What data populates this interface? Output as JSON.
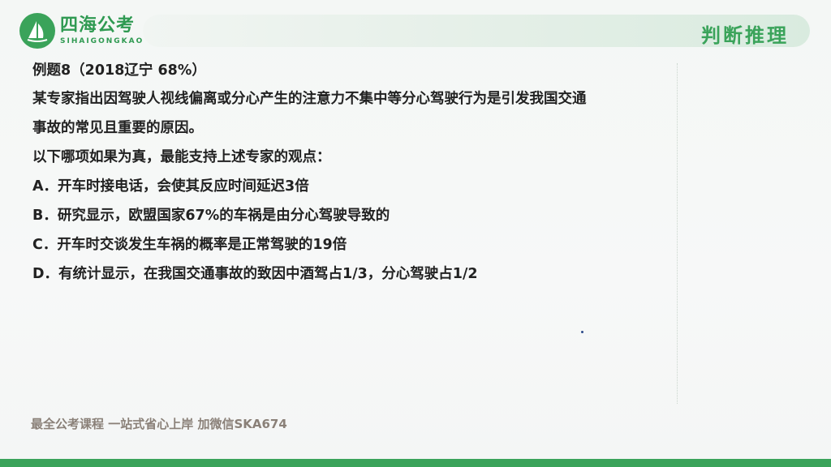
{
  "brand": {
    "name_cn": "四海公考",
    "name_en": "SIHAIGONGKAO",
    "color": "#3aa35a"
  },
  "header": {
    "title": "判断推理"
  },
  "question": {
    "title": "例题8（2018辽宁 68%）",
    "stem_line1": "某专家指出因驾驶人视线偏离或分心产生的注意力不集中等分心驾驶行为是引发我国交通",
    "stem_line2": "事故的常见且重要的原因。",
    "prompt": "以下哪项如果为真，最能支持上述专家的观点：",
    "options": [
      "A．开车时接电话，会使其反应时间延迟3倍",
      "B．研究显示，欧盟国家67%的车祸是由分心驾驶导致的",
      "C．开车时交谈发生车祸的概率是正常驾驶的19倍",
      "D．有统计显示，在我国交通事故的致因中酒驾占1/3，分心驾驶占1/2"
    ]
  },
  "footer": {
    "promo": "最全公考课程 一站式省心上岸 加微信SKA674"
  }
}
